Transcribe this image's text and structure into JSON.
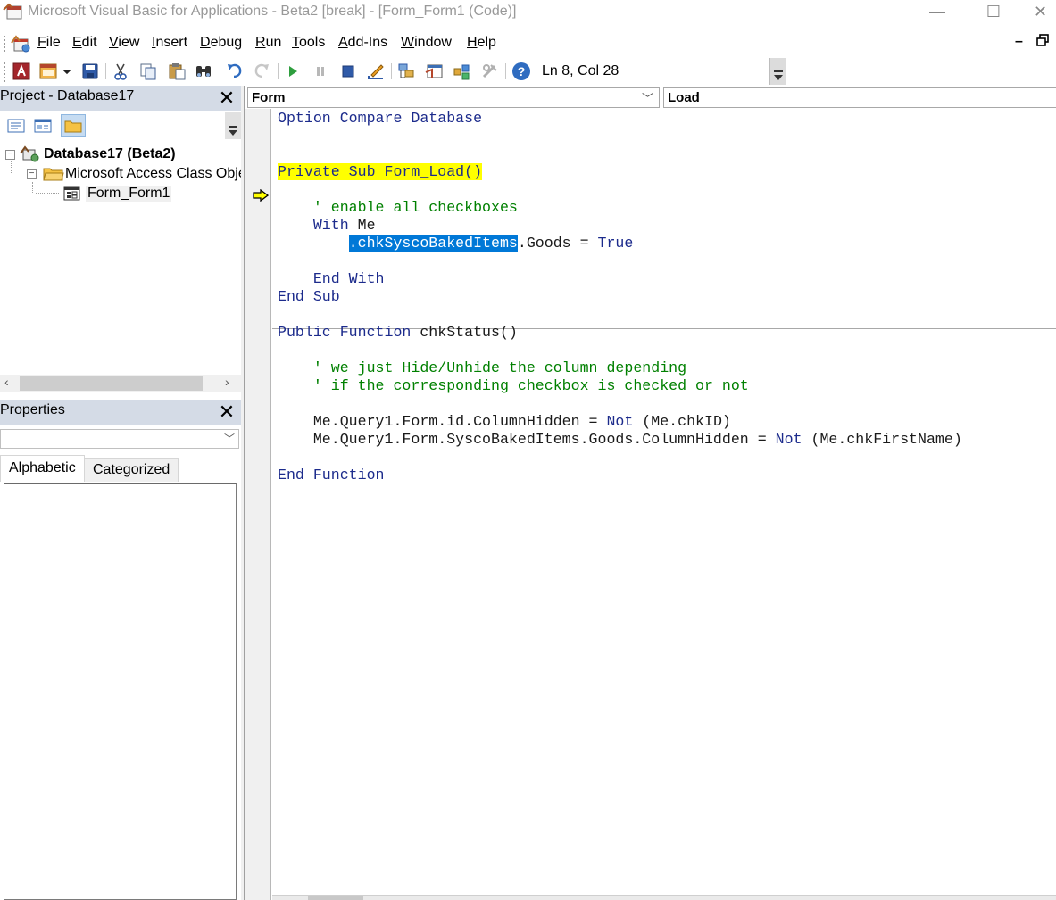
{
  "window": {
    "title": "Microsoft Visual Basic for Applications - Beta2 [break] - [Form_Form1 (Code)]",
    "minimize_glyph": "—",
    "maximize_glyph": "☐",
    "close_glyph": "✕"
  },
  "menu": {
    "items": [
      {
        "acc": "F",
        "rest": "ile"
      },
      {
        "acc": "E",
        "rest": "dit"
      },
      {
        "acc": "V",
        "rest": "iew"
      },
      {
        "acc": "I",
        "rest": "nsert"
      },
      {
        "acc": "D",
        "rest": "ebug"
      },
      {
        "acc": "R",
        "rest": "un"
      },
      {
        "acc": "T",
        "rest": "ools"
      },
      {
        "acc": "A",
        "rest": "dd-Ins"
      },
      {
        "acc": "W",
        "rest": "indow"
      },
      {
        "acc": "H",
        "rest": "elp"
      }
    ],
    "mdi_minimize_glyph": "–"
  },
  "toolbar": {
    "cursor_position": "Ln 8, Col 28",
    "icons": [
      "access-view-icon",
      "insert-userform-icon",
      "save-icon",
      "cut-icon",
      "copy-icon",
      "paste-icon",
      "find-icon",
      "undo-icon",
      "redo-icon",
      "run-icon",
      "break-icon",
      "reset-icon",
      "design-mode-icon",
      "project-explorer-icon",
      "properties-window-icon",
      "object-browser-icon",
      "toolbox-icon",
      "help-icon"
    ]
  },
  "project_pane": {
    "title": "Project - Database17",
    "close_glyph": "✕",
    "tree": {
      "root": "Database17 (Beta2)",
      "folder": "Microsoft Access Class Obje",
      "module": "Form_Form1"
    },
    "scroll_left": "‹",
    "scroll_right": "›"
  },
  "properties_pane": {
    "title": "Properties",
    "close_glyph": "✕",
    "object_value": "",
    "tabs": [
      "Alphabetic",
      "Categorized"
    ],
    "active_tab": "Alphabetic"
  },
  "code_window": {
    "object_combo": "Form",
    "procedure_combo": "Load",
    "lines": {
      "l1": {
        "kw": "Option Compare Database"
      },
      "l4": {
        "exec": "Private Sub Form_Load()"
      },
      "l6": {
        "cm": "    ' enable all checkboxes"
      },
      "l7": {
        "kw": "    With",
        "rest": " Me"
      },
      "l8": {
        "indent": "        ",
        "sel": ".chkSyscoBakedItems",
        "rest": ".Goods = ",
        "kw2": "True"
      },
      "l10": {
        "kw": "    End With"
      },
      "l11": {
        "kw": "End Sub"
      },
      "l13": {
        "kw": "Public Function",
        "rest": " chkStatus()"
      },
      "l15": {
        "cm": "    ' we just Hide/Unhide the column depending"
      },
      "l16": {
        "cm": "    ' if the corresponding checkbox is checked or not"
      },
      "l18": {
        "rest": "    Me.Query1.Form.id.ColumnHidden = ",
        "kw2": "Not",
        "rest2": " (Me.chkID)"
      },
      "l19": {
        "rest": "    Me.Query1.Form.SyscoBakedItems.Goods.ColumnHidden = ",
        "kw2": "Not",
        "rest2": " (Me.chkFirstName)"
      },
      "l21": {
        "kw": "End Function"
      }
    }
  },
  "colors": {
    "keyword": "#1c2b8c",
    "comment": "#008000",
    "execution_highlight": "#ffff00",
    "selection": "#0078d7",
    "pane_header": "#d4dbe6"
  }
}
